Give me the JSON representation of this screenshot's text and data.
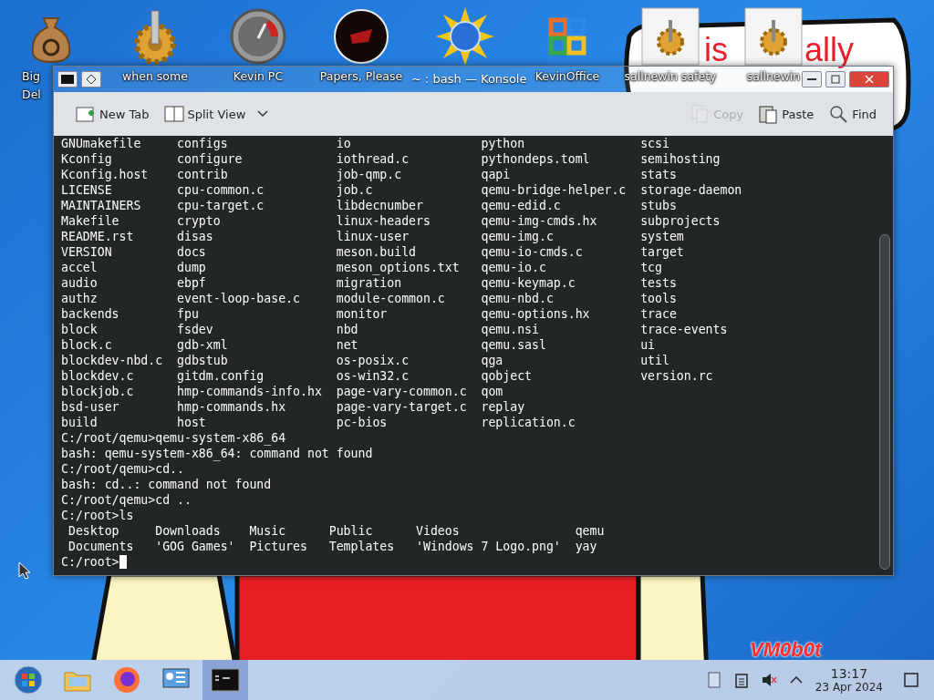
{
  "desktop_icons": [
    {
      "kind": "money-bag",
      "lines": [
        "Big",
        "Del"
      ]
    },
    {
      "kind": "gear",
      "lines": [
        "when some"
      ]
    },
    {
      "kind": "gauge",
      "lines": [
        "Kevin PC"
      ]
    },
    {
      "kind": "red-disc",
      "lines": [
        "Papers, Please"
      ]
    },
    {
      "kind": "sun-globe"
    },
    {
      "kind": "office",
      "lines": [
        "KevinOffice"
      ]
    },
    {
      "kind": "gear-tile",
      "lines": [
        "sallnewin safety"
      ]
    },
    {
      "kind": "gear-tile",
      "lines": [
        "sallnewin"
      ]
    }
  ],
  "wallpaper": {
    "texts": [
      "is",
      "ally"
    ],
    "signature": "VM0b0t"
  },
  "window": {
    "title": "~ : bash — Konsole"
  },
  "toolbar": {
    "buttons": [
      {
        "kind": "new-tab",
        "label": "New Tab",
        "disabled": false
      },
      {
        "kind": "split-view",
        "label": "Split View",
        "disabled": false
      },
      {
        "kind": "copy",
        "label": "Copy",
        "disabled": true
      },
      {
        "kind": "paste",
        "label": "Paste",
        "disabled": false
      },
      {
        "kind": "find",
        "label": "Find",
        "disabled": false
      }
    ]
  },
  "terminal": {
    "listing": [
      [
        "GNUmakefile",
        "configs",
        "io",
        "python",
        "scsi"
      ],
      [
        "Kconfig",
        "configure",
        "iothread.c",
        "pythondeps.toml",
        "semihosting"
      ],
      [
        "Kconfig.host",
        "contrib",
        "job-qmp.c",
        "qapi",
        "stats"
      ],
      [
        "LICENSE",
        "cpu-common.c",
        "job.c",
        "qemu-bridge-helper.c",
        "storage-daemon"
      ],
      [
        "MAINTAINERS",
        "cpu-target.c",
        "libdecnumber",
        "qemu-edid.c",
        "stubs"
      ],
      [
        "Makefile",
        "crypto",
        "linux-headers",
        "qemu-img-cmds.hx",
        "subprojects"
      ],
      [
        "README.rst",
        "disas",
        "linux-user",
        "qemu-img.c",
        "system"
      ],
      [
        "VERSION",
        "docs",
        "meson.build",
        "qemu-io-cmds.c",
        "target"
      ],
      [
        "accel",
        "dump",
        "meson_options.txt",
        "qemu-io.c",
        "tcg"
      ],
      [
        "audio",
        "ebpf",
        "migration",
        "qemu-keymap.c",
        "tests"
      ],
      [
        "authz",
        "event-loop-base.c",
        "module-common.c",
        "qemu-nbd.c",
        "tools"
      ],
      [
        "backends",
        "fpu",
        "monitor",
        "qemu-options.hx",
        "trace"
      ],
      [
        "block",
        "fsdev",
        "nbd",
        "qemu.nsi",
        "trace-events"
      ],
      [
        "block.c",
        "gdb-xml",
        "net",
        "qemu.sasl",
        "ui"
      ],
      [
        "blockdev-nbd.c",
        "gdbstub",
        "os-posix.c",
        "qga",
        "util"
      ],
      [
        "blockdev.c",
        "gitdm.config",
        "os-win32.c",
        "qobject",
        "version.rc"
      ],
      [
        "blockjob.c",
        "hmp-commands-info.hx",
        "page-vary-common.c",
        "qom"
      ],
      [
        "bsd-user",
        "hmp-commands.hx",
        "page-vary-target.c",
        "replay"
      ],
      [
        "build",
        "host",
        "pc-bios",
        "replication.c"
      ]
    ],
    "lines": [
      "C:/root/qemu>qemu-system-x86_64",
      "bash: qemu-system-x86_64: command not found",
      "C:/root/qemu>cd..",
      "bash: cd..: command not found",
      "C:/root/qemu>cd ..",
      "C:/root>ls"
    ],
    "home_listing": [
      [
        "Desktop",
        "Downloads",
        "Music",
        "Public",
        "Videos",
        "qemu"
      ],
      [
        "Documents",
        "'GOG Games'",
        "Pictures",
        "Templates",
        "'Windows 7 Logo.png'",
        "yay"
      ]
    ],
    "prompt": "C:/root>"
  },
  "taskbar": {
    "apps": [
      {
        "kind": "start",
        "selected": false
      },
      {
        "kind": "folder",
        "selected": false
      },
      {
        "kind": "firefox",
        "selected": false
      },
      {
        "kind": "control-panel",
        "selected": false
      },
      {
        "kind": "terminal",
        "selected": true
      }
    ],
    "tray": [
      {
        "kind": "notes"
      },
      {
        "kind": "clipboard"
      },
      {
        "kind": "muted-speaker"
      },
      {
        "kind": "chevron"
      }
    ],
    "time": "13:17",
    "date": "23 Apr 2024"
  }
}
